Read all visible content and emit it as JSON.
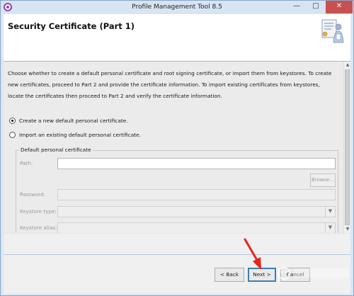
{
  "window": {
    "title": "Profile Management Tool 8.5",
    "minimize": "—",
    "maximize": "□",
    "close": "✕"
  },
  "header": {
    "title": "Security Certificate (Part 1)",
    "icon": "wizard-certificate-icon"
  },
  "content": {
    "description": "Choose whether to create a default personal certificate and root signing certificate, or import them from keystores. To create new certificates, proceed to Part 2 and provide the certificate information. To import existing certificates from keystores, locate the certificates then proceed to Part 2 and verify the certificate information.",
    "options": [
      {
        "label": "Create a new default personal certificate.",
        "selected": true
      },
      {
        "label": "Import an existing default personal certificate.",
        "selected": false
      }
    ],
    "group": {
      "title": "Default personal certificate",
      "path_label": "Path:",
      "path_value": "",
      "browse_label": "Browse...",
      "password_label": "Password:",
      "keystore_type_label": "Keystore type:",
      "keystore_alias_label": "Keystore alias:"
    }
  },
  "footer": {
    "back_label": "< Back",
    "next_label": "Next >",
    "cancel_label": "Cancel"
  },
  "colors": {
    "title_bar": "#d7e4f2",
    "close_button": "#c75050",
    "annotation_arrow": "#e8231e",
    "focus_border": "#3c7fb1"
  }
}
